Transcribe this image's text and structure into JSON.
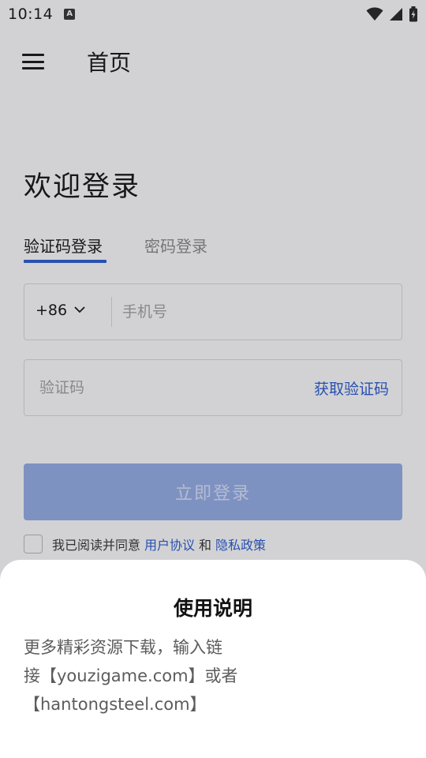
{
  "status_bar": {
    "time": "10:14",
    "notification_icon_letter": "A",
    "icons": [
      "wifi-icon",
      "signal-icon",
      "battery-icon"
    ]
  },
  "app_bar": {
    "title": "首页",
    "menu_icon": "menu-icon"
  },
  "login": {
    "welcome": "欢迎登录",
    "tabs": [
      {
        "label": "验证码登录",
        "active": true
      },
      {
        "label": "密码登录",
        "active": false
      }
    ],
    "country_code": "+86",
    "phone_placeholder": "手机号",
    "phone_value": "",
    "code_placeholder": "验证码",
    "code_value": "",
    "get_code_label": "获取验证码",
    "login_button": "立即登录",
    "agreement": {
      "checked": false,
      "prefix": "我已阅读并同意",
      "user_agreement": "用户协议",
      "conjunction": "和",
      "privacy_policy": "隐私政策"
    }
  },
  "sheet": {
    "title": "使用说明",
    "lines": [
      "更多精彩资源下载，输入链",
      "接【youzigame.com】或者",
      "【hantongsteel.com】"
    ]
  },
  "colors": {
    "accent": "#2e5fd0",
    "button_disabled": "#98b0e8",
    "overlay": "rgba(18,18,30,0.19)"
  }
}
